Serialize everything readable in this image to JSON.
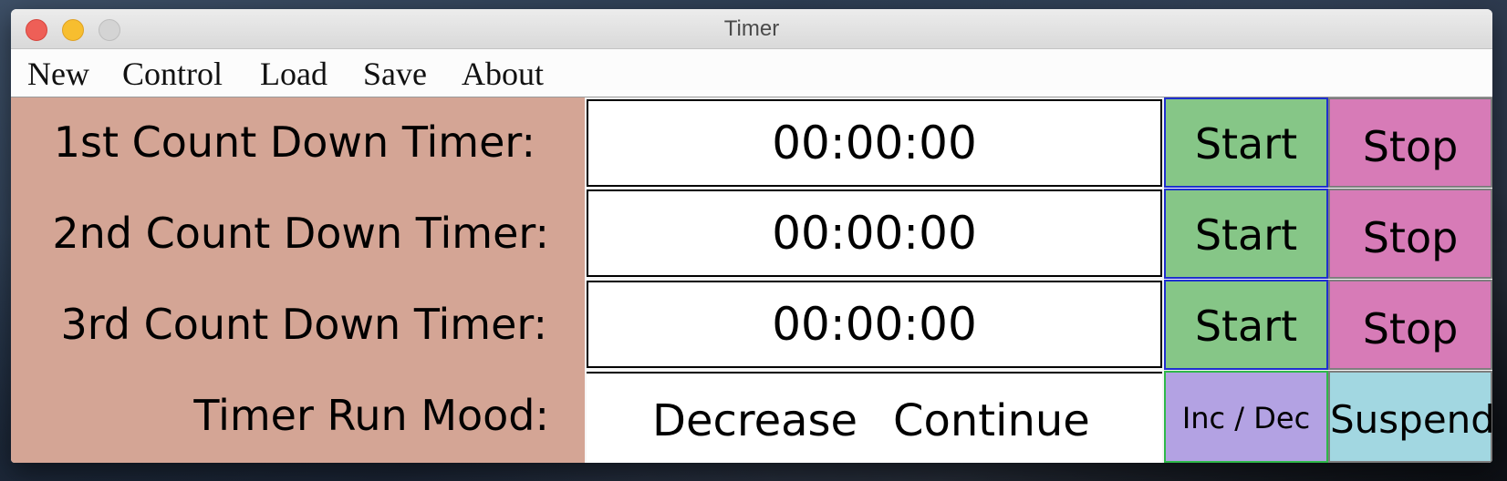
{
  "window": {
    "title": "Timer"
  },
  "menu": {
    "items": [
      {
        "label": "New"
      },
      {
        "label": "Control"
      },
      {
        "label": "Load"
      },
      {
        "label": "Save"
      },
      {
        "label": "About"
      }
    ]
  },
  "timers": [
    {
      "label": "1st Count Down Timer:",
      "value": "00:00:00",
      "start_label": "Start",
      "stop_label": "Stop"
    },
    {
      "label": "2nd Count Down Timer:",
      "value": "00:00:00",
      "start_label": "Start",
      "stop_label": "Stop"
    },
    {
      "label": "3rd Count Down Timer:",
      "value": "00:00:00",
      "start_label": "Start",
      "stop_label": "Stop"
    }
  ],
  "run_mode": {
    "label": "Timer Run Mood:",
    "direction": "Decrease",
    "behavior": "Continue",
    "inc_dec_label": "Inc / Dec",
    "suspend_label": "Suspend"
  },
  "colors": {
    "label_panel": "#d4a595",
    "start_button": "#86c687",
    "stop_button": "#d77bb7",
    "inc_dec_button": "#b3a2e3",
    "suspend_button": "#a2d7e1"
  }
}
